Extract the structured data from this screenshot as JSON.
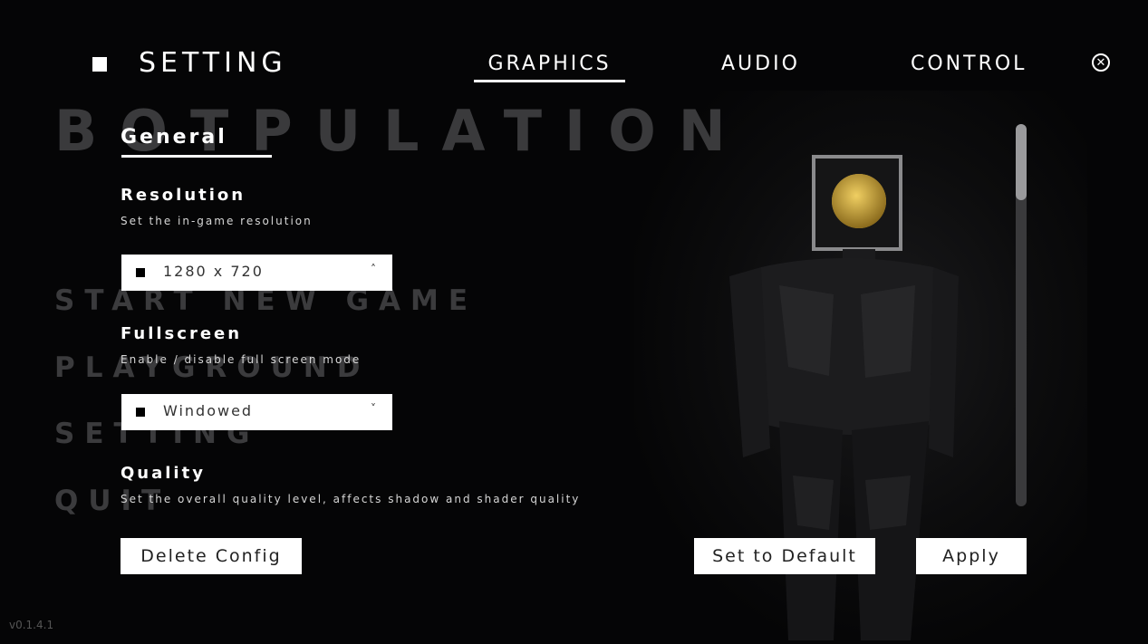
{
  "background": {
    "game_title": "BOTPULATION",
    "menu_items": [
      "START NEW GAME",
      "PLAYGROUND",
      "SETTING",
      "QUIT"
    ]
  },
  "header": {
    "title": "SETTING",
    "tabs": [
      {
        "label": "GRAPHICS",
        "active": true
      },
      {
        "label": "AUDIO",
        "active": false
      },
      {
        "label": "CONTROL",
        "active": false
      }
    ],
    "close_icon": "close-circle-icon"
  },
  "panel": {
    "section_title": "General",
    "settings": [
      {
        "name": "Resolution",
        "description": "Set the in-game resolution",
        "value": "1280 x 720",
        "arrow": "˄"
      },
      {
        "name": "Fullscreen",
        "description": "Enable / disable full screen mode",
        "value": "Windowed",
        "arrow": "˅"
      },
      {
        "name": "Quality",
        "description": "Set the overall quality level, affects shadow and shader quality"
      }
    ]
  },
  "buttons": {
    "delete": "Delete Config",
    "default": "Set to Default",
    "apply": "Apply"
  },
  "version": "v0.1.4.1",
  "colors": {
    "background": "#050506",
    "accent": "#ffffff",
    "dim_text": "#3b3b3d"
  }
}
